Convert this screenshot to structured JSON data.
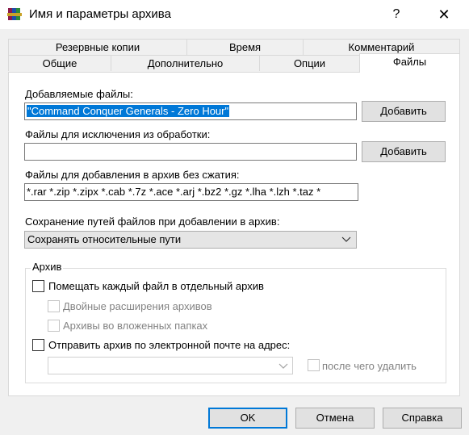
{
  "window": {
    "title": "Имя и параметры архива",
    "help_glyph": "?",
    "close_glyph": "✕",
    "app_icon": "winrar-books-icon"
  },
  "tabs": {
    "row1": [
      {
        "label": "Резервные копии"
      },
      {
        "label": "Время"
      },
      {
        "label": "Комментарий"
      }
    ],
    "row2": [
      {
        "label": "Общие"
      },
      {
        "label": "Дополнительно"
      },
      {
        "label": "Опции"
      },
      {
        "label": "Файлы",
        "active": true
      }
    ]
  },
  "files": {
    "add_label": "Добавляемые файлы:",
    "add_value": "\"Command Conquer Generals - Zero Hour\"",
    "add_button": "Добавить",
    "exclude_label": "Файлы для исключения из обработки:",
    "exclude_value": "",
    "exclude_button": "Добавить",
    "nocompress_label": "Файлы для добавления в архив без сжатия:",
    "nocompress_value": "*.rar *.zip *.zipx *.cab *.7z *.ace *.arj *.bz2 *.gz *.lha *.lzh *.taz *",
    "paths_label": "Сохранение путей файлов при добавлении в архив:",
    "paths_selected": "Сохранять относительные пути"
  },
  "archive_group": {
    "title": "Архив",
    "separate_archives": {
      "label": "Помещать каждый файл в отдельный архив",
      "checked": false
    },
    "double_ext": {
      "label": "Двойные расширения архивов",
      "checked": false,
      "disabled": true
    },
    "nested_folders": {
      "label": "Архивы во вложенных папках",
      "checked": false,
      "disabled": true
    },
    "email": {
      "label": "Отправить архив по электронной почте на адрес:",
      "checked": false
    },
    "email_value": "",
    "delete_after": {
      "label": "после чего удалить",
      "checked": false,
      "disabled": true
    }
  },
  "footer": {
    "ok": "OK",
    "cancel": "Отмена",
    "help": "Справка"
  },
  "colors": {
    "accent": "#0078d7",
    "window_bg": "#f0f0f0",
    "panel_bg": "#ffffff",
    "disabled_text": "#838383"
  }
}
